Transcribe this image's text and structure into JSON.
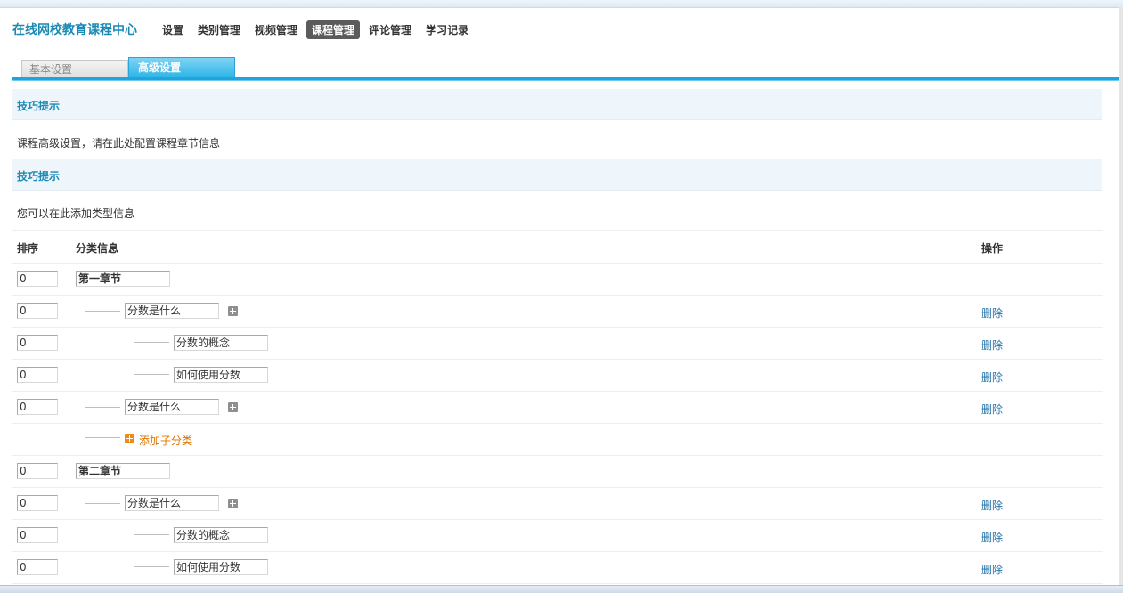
{
  "header": {
    "site_title": "在线网校教育课程中心",
    "nav": [
      "设置",
      "类别管理",
      "视频管理",
      "课程管理",
      "评论管理",
      "学习记录"
    ],
    "active_nav_index": 3
  },
  "tabs": {
    "basic": "基本设置",
    "advanced": "高级设置"
  },
  "tips1": {
    "title": "技巧提示",
    "text": "课程高级设置，请在此处配置课程章节信息"
  },
  "tips2": {
    "title": "技巧提示",
    "text": "您可以在此添加类型信息"
  },
  "table": {
    "col_sort": "排序",
    "col_info": "分类信息",
    "col_action": "操作",
    "delete_label": "删除",
    "add_sub_label": "添加子分类",
    "rows": [
      {
        "sort": "0",
        "name": "第一章节"
      },
      {
        "sort": "0",
        "name": "分数是什么"
      },
      {
        "sort": "0",
        "name": "分数的概念"
      },
      {
        "sort": "0",
        "name": "如何使用分数"
      },
      {
        "sort": "0",
        "name": "分数是什么"
      },
      {
        "sort": "0",
        "name": "第二章节"
      },
      {
        "sort": "0",
        "name": "分数是什么"
      },
      {
        "sort": "0",
        "name": "分数的概念"
      },
      {
        "sort": "0",
        "name": "如何使用分数"
      }
    ]
  }
}
